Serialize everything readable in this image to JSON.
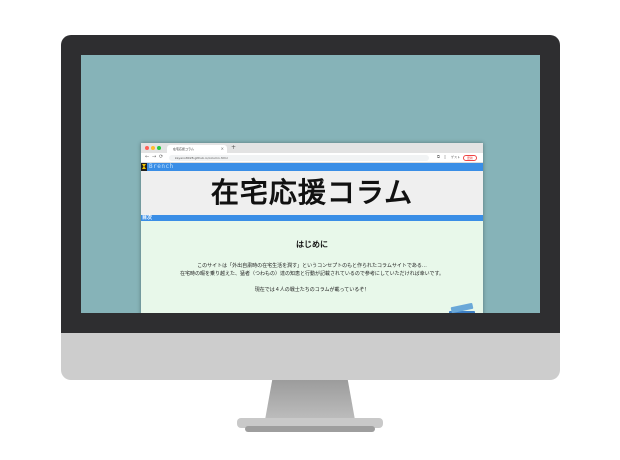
{
  "browser": {
    "tab_title": "在宅応援コラム",
    "tab_close": "×",
    "new_tab": "+",
    "nav_back": "←",
    "nav_forward": "→",
    "nav_reload": "⟳",
    "url": "kayano8028.github.io/column.html",
    "profile_label": "ゲスト",
    "update_label": "更新"
  },
  "site": {
    "brand": "Brench",
    "title": "在宅応援コラム",
    "toc_label": "目次"
  },
  "intro": {
    "heading": "はじめに",
    "line1": "このサイトは「外出自粛時の在宅生活を潤す」というコンセプトのもと作られたコラムサイトである…",
    "line2": "在宅時の暇を乗り越えた、猛者（つわもの）達の知恵と行動が記載されているので参考にしていただければ幸いです。",
    "line3": "現在では４人の戦士たちのコラムが載っているぞ！"
  },
  "colors": {
    "screen_bg": "#86b3b8",
    "accent_blue": "#3a8ee6",
    "content_bg": "#e8f8ea",
    "banner_bg": "#efefef"
  }
}
